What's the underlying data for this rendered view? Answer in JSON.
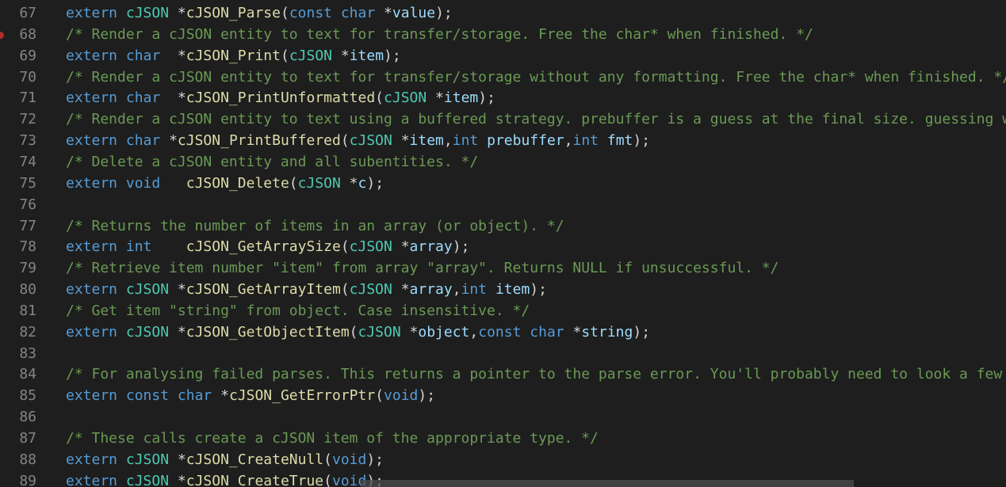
{
  "editor": {
    "lines": [
      {
        "num": "67",
        "breakpoint": false,
        "tokens": [
          {
            "t": "extern",
            "c": "kw"
          },
          {
            "t": " ",
            "c": "pl"
          },
          {
            "t": "cJSON",
            "c": "type"
          },
          {
            "t": " *",
            "c": "pl"
          },
          {
            "t": "cJSON_Parse",
            "c": "fn"
          },
          {
            "t": "(",
            "c": "pl"
          },
          {
            "t": "const",
            "c": "kw"
          },
          {
            "t": " ",
            "c": "pl"
          },
          {
            "t": "char",
            "c": "kw"
          },
          {
            "t": " *",
            "c": "pl"
          },
          {
            "t": "value",
            "c": "var"
          },
          {
            "t": ");",
            "c": "pl"
          }
        ]
      },
      {
        "num": "68",
        "breakpoint": true,
        "tokens": [
          {
            "t": "/* Render a cJSON entity to text for transfer/storage. Free the char* when finished. */",
            "c": "cm"
          }
        ]
      },
      {
        "num": "69",
        "breakpoint": false,
        "tokens": [
          {
            "t": "extern",
            "c": "kw"
          },
          {
            "t": " ",
            "c": "pl"
          },
          {
            "t": "char",
            "c": "kw"
          },
          {
            "t": "  *",
            "c": "pl"
          },
          {
            "t": "cJSON_Print",
            "c": "fn"
          },
          {
            "t": "(",
            "c": "pl"
          },
          {
            "t": "cJSON",
            "c": "type"
          },
          {
            "t": " *",
            "c": "pl"
          },
          {
            "t": "item",
            "c": "var"
          },
          {
            "t": ");",
            "c": "pl"
          }
        ]
      },
      {
        "num": "70",
        "breakpoint": false,
        "tokens": [
          {
            "t": "/* Render a cJSON entity to text for transfer/storage without any formatting. Free the char* when finished. */",
            "c": "cm"
          }
        ]
      },
      {
        "num": "71",
        "breakpoint": false,
        "tokens": [
          {
            "t": "extern",
            "c": "kw"
          },
          {
            "t": " ",
            "c": "pl"
          },
          {
            "t": "char",
            "c": "kw"
          },
          {
            "t": "  *",
            "c": "pl"
          },
          {
            "t": "cJSON_PrintUnformatted",
            "c": "fn"
          },
          {
            "t": "(",
            "c": "pl"
          },
          {
            "t": "cJSON",
            "c": "type"
          },
          {
            "t": " *",
            "c": "pl"
          },
          {
            "t": "item",
            "c": "var"
          },
          {
            "t": ");",
            "c": "pl"
          }
        ]
      },
      {
        "num": "72",
        "breakpoint": false,
        "tokens": [
          {
            "t": "/* Render a cJSON entity to text using a buffered strategy. prebuffer is a guess at the final size. guessing well",
            "c": "cm"
          }
        ]
      },
      {
        "num": "73",
        "breakpoint": false,
        "tokens": [
          {
            "t": "extern",
            "c": "kw"
          },
          {
            "t": " ",
            "c": "pl"
          },
          {
            "t": "char",
            "c": "kw"
          },
          {
            "t": " *",
            "c": "pl"
          },
          {
            "t": "cJSON_PrintBuffered",
            "c": "fn"
          },
          {
            "t": "(",
            "c": "pl"
          },
          {
            "t": "cJSON",
            "c": "type"
          },
          {
            "t": " *",
            "c": "pl"
          },
          {
            "t": "item",
            "c": "var"
          },
          {
            "t": ",",
            "c": "pl"
          },
          {
            "t": "int",
            "c": "kw"
          },
          {
            "t": " ",
            "c": "pl"
          },
          {
            "t": "prebuffer",
            "c": "var"
          },
          {
            "t": ",",
            "c": "pl"
          },
          {
            "t": "int",
            "c": "kw"
          },
          {
            "t": " ",
            "c": "pl"
          },
          {
            "t": "fmt",
            "c": "var"
          },
          {
            "t": ");",
            "c": "pl"
          }
        ]
      },
      {
        "num": "74",
        "breakpoint": false,
        "tokens": [
          {
            "t": "/* Delete a cJSON entity and all subentities. */",
            "c": "cm"
          }
        ]
      },
      {
        "num": "75",
        "breakpoint": false,
        "tokens": [
          {
            "t": "extern",
            "c": "kw"
          },
          {
            "t": " ",
            "c": "pl"
          },
          {
            "t": "void",
            "c": "kw"
          },
          {
            "t": "   ",
            "c": "pl"
          },
          {
            "t": "cJSON_Delete",
            "c": "fn"
          },
          {
            "t": "(",
            "c": "pl"
          },
          {
            "t": "cJSON",
            "c": "type"
          },
          {
            "t": " *",
            "c": "pl"
          },
          {
            "t": "c",
            "c": "var"
          },
          {
            "t": ");",
            "c": "pl"
          }
        ]
      },
      {
        "num": "76",
        "breakpoint": false,
        "tokens": []
      },
      {
        "num": "77",
        "breakpoint": false,
        "tokens": [
          {
            "t": "/* Returns the number of items in an array (or object). */",
            "c": "cm"
          }
        ]
      },
      {
        "num": "78",
        "breakpoint": false,
        "tokens": [
          {
            "t": "extern",
            "c": "kw"
          },
          {
            "t": " ",
            "c": "pl"
          },
          {
            "t": "int",
            "c": "kw"
          },
          {
            "t": "    ",
            "c": "pl"
          },
          {
            "t": "cJSON_GetArraySize",
            "c": "fn"
          },
          {
            "t": "(",
            "c": "pl"
          },
          {
            "t": "cJSON",
            "c": "type"
          },
          {
            "t": " *",
            "c": "pl"
          },
          {
            "t": "array",
            "c": "var"
          },
          {
            "t": ");",
            "c": "pl"
          }
        ]
      },
      {
        "num": "79",
        "breakpoint": false,
        "tokens": [
          {
            "t": "/* Retrieve item number \"item\" from array \"array\". Returns NULL if unsuccessful. */",
            "c": "cm"
          }
        ]
      },
      {
        "num": "80",
        "breakpoint": false,
        "tokens": [
          {
            "t": "extern",
            "c": "kw"
          },
          {
            "t": " ",
            "c": "pl"
          },
          {
            "t": "cJSON",
            "c": "type"
          },
          {
            "t": " *",
            "c": "pl"
          },
          {
            "t": "cJSON_GetArrayItem",
            "c": "fn"
          },
          {
            "t": "(",
            "c": "pl"
          },
          {
            "t": "cJSON",
            "c": "type"
          },
          {
            "t": " *",
            "c": "pl"
          },
          {
            "t": "array",
            "c": "var"
          },
          {
            "t": ",",
            "c": "pl"
          },
          {
            "t": "int",
            "c": "kw"
          },
          {
            "t": " ",
            "c": "pl"
          },
          {
            "t": "item",
            "c": "var"
          },
          {
            "t": ");",
            "c": "pl"
          }
        ]
      },
      {
        "num": "81",
        "breakpoint": false,
        "tokens": [
          {
            "t": "/* Get item \"string\" from object. Case insensitive. */",
            "c": "cm"
          }
        ]
      },
      {
        "num": "82",
        "breakpoint": false,
        "tokens": [
          {
            "t": "extern",
            "c": "kw"
          },
          {
            "t": " ",
            "c": "pl"
          },
          {
            "t": "cJSON",
            "c": "type"
          },
          {
            "t": " *",
            "c": "pl"
          },
          {
            "t": "cJSON_GetObjectItem",
            "c": "fn"
          },
          {
            "t": "(",
            "c": "pl"
          },
          {
            "t": "cJSON",
            "c": "type"
          },
          {
            "t": " *",
            "c": "pl"
          },
          {
            "t": "object",
            "c": "var"
          },
          {
            "t": ",",
            "c": "pl"
          },
          {
            "t": "const",
            "c": "kw"
          },
          {
            "t": " ",
            "c": "pl"
          },
          {
            "t": "char",
            "c": "kw"
          },
          {
            "t": " *",
            "c": "pl"
          },
          {
            "t": "string",
            "c": "var"
          },
          {
            "t": ");",
            "c": "pl"
          }
        ]
      },
      {
        "num": "83",
        "breakpoint": false,
        "tokens": []
      },
      {
        "num": "84",
        "breakpoint": false,
        "tokens": [
          {
            "t": "/* For analysing failed parses. This returns a pointer to the parse error. You'll probably need to look a few chars",
            "c": "cm"
          }
        ]
      },
      {
        "num": "85",
        "breakpoint": false,
        "tokens": [
          {
            "t": "extern",
            "c": "kw"
          },
          {
            "t": " ",
            "c": "pl"
          },
          {
            "t": "const",
            "c": "kw"
          },
          {
            "t": " ",
            "c": "pl"
          },
          {
            "t": "char",
            "c": "kw"
          },
          {
            "t": " *",
            "c": "pl"
          },
          {
            "t": "cJSON_GetErrorPtr",
            "c": "fn"
          },
          {
            "t": "(",
            "c": "pl"
          },
          {
            "t": "void",
            "c": "kw"
          },
          {
            "t": ");",
            "c": "pl"
          }
        ]
      },
      {
        "num": "86",
        "breakpoint": false,
        "tokens": []
      },
      {
        "num": "87",
        "breakpoint": false,
        "tokens": [
          {
            "t": "/* These calls create a cJSON item of the appropriate type. */",
            "c": "cm"
          }
        ]
      },
      {
        "num": "88",
        "breakpoint": false,
        "tokens": [
          {
            "t": "extern",
            "c": "kw"
          },
          {
            "t": " ",
            "c": "pl"
          },
          {
            "t": "cJSON",
            "c": "type"
          },
          {
            "t": " *",
            "c": "pl"
          },
          {
            "t": "cJSON_CreateNull",
            "c": "fn"
          },
          {
            "t": "(",
            "c": "pl"
          },
          {
            "t": "void",
            "c": "kw"
          },
          {
            "t": ");",
            "c": "pl"
          }
        ]
      },
      {
        "num": "89",
        "breakpoint": false,
        "tokens": [
          {
            "t": "extern",
            "c": "kw"
          },
          {
            "t": " ",
            "c": "pl"
          },
          {
            "t": "cJSON",
            "c": "type"
          },
          {
            "t": " *",
            "c": "pl"
          },
          {
            "t": "cJSON_CreateTrue",
            "c": "fn"
          },
          {
            "t": "(",
            "c": "pl"
          },
          {
            "t": "void",
            "c": "kw"
          },
          {
            "t": ");",
            "c": "pl"
          }
        ]
      }
    ]
  },
  "theme": {
    "background": "#1e1e1e",
    "line_number": "#858585",
    "keyword": "#569cd6",
    "type": "#4ec9b0",
    "function": "#dcdcaa",
    "variable": "#9cdcfe",
    "comment": "#6a9955",
    "plain": "#d4d4d4",
    "breakpoint": "#b22c2c"
  }
}
